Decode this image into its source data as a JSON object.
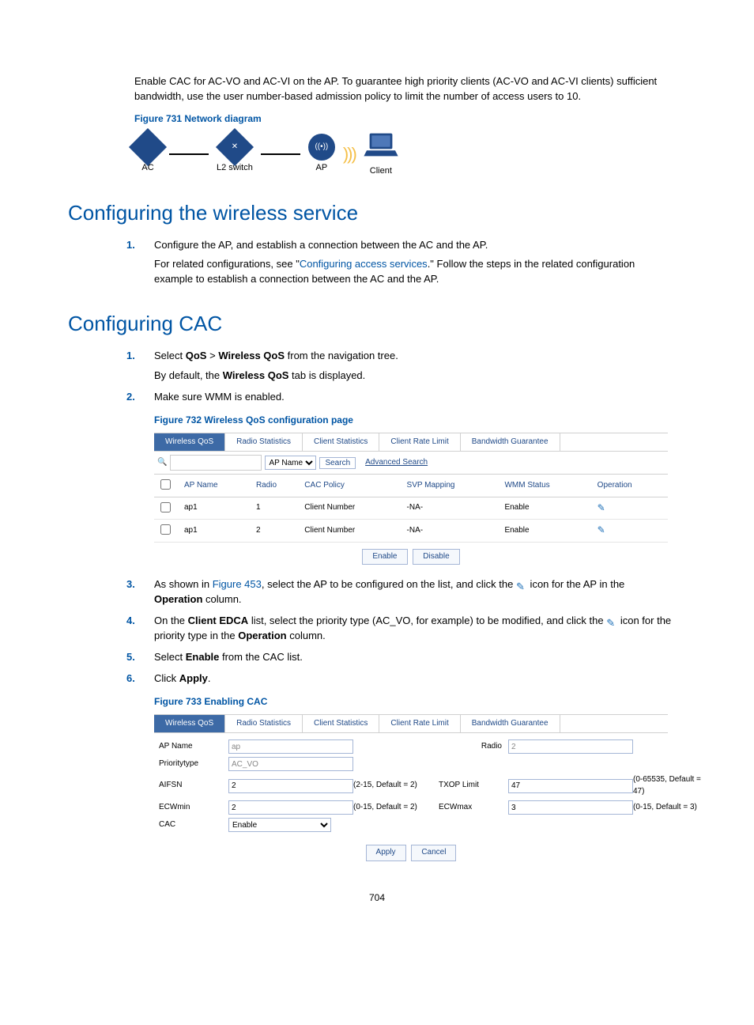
{
  "intro_paragraph": "Enable CAC for AC-VO and AC-VI on the AP. To guarantee high priority clients (AC-VO and AC-VI clients) sufficient bandwidth, use the user number-based admission policy to limit the number of access users to 10.",
  "fig731": {
    "caption": "Figure 731 Network diagram",
    "nodes": {
      "ac": "AC",
      "switch": "L2 switch",
      "ap": "AP",
      "client": "Client"
    }
  },
  "section1": {
    "title": "Configuring the wireless service",
    "steps": [
      {
        "line1": "Configure the AP, and establish a connection between the AC and the AP.",
        "line2_pre": "For related configurations, see \"",
        "line2_link": "Configuring access services",
        "line2_post": ".\" Follow the steps in the related configuration example to establish a connection between the AC and the AP."
      }
    ]
  },
  "section2": {
    "title": "Configuring CAC",
    "steps": [
      {
        "parts": [
          {
            "t": "Select "
          },
          {
            "b": "QoS"
          },
          {
            "t": " > "
          },
          {
            "b": "Wireless QoS"
          },
          {
            "t": " from the navigation tree."
          }
        ],
        "line2": [
          {
            "t": "By default, the "
          },
          {
            "b": "Wireless QoS"
          },
          {
            "t": " tab is displayed."
          }
        ]
      },
      {
        "parts": [
          {
            "t": "Make sure WMM is enabled."
          }
        ]
      }
    ],
    "steps_after_fig732": [
      {
        "num": "3.",
        "parts": [
          {
            "t": "As shown in "
          },
          {
            "link": "Figure 453"
          },
          {
            "t": ", select the AP to be configured on the list, and click the "
          },
          {
            "icon": true
          },
          {
            "t": " icon for the AP in the "
          },
          {
            "b": "Operation"
          },
          {
            "t": " column."
          }
        ]
      },
      {
        "num": "4.",
        "parts": [
          {
            "t": "On the "
          },
          {
            "b": "Client EDCA"
          },
          {
            "t": " list, select the priority type (AC_VO, for example) to be modified, and click the "
          },
          {
            "icon": true
          },
          {
            "t": " icon for the priority type in the "
          },
          {
            "b": "Operation"
          },
          {
            "t": " column."
          }
        ]
      },
      {
        "num": "5.",
        "parts": [
          {
            "t": "Select "
          },
          {
            "b": "Enable"
          },
          {
            "t": " from the CAC list."
          }
        ]
      },
      {
        "num": "6.",
        "parts": [
          {
            "t": "Click "
          },
          {
            "b": "Apply"
          },
          {
            "t": "."
          }
        ]
      }
    ]
  },
  "fig732": {
    "caption": "Figure 732 Wireless QoS configuration page",
    "tabs": [
      "Wireless QoS",
      "Radio Statistics",
      "Client Statistics",
      "Client Rate Limit",
      "Bandwidth Guarantee"
    ],
    "active_tab": 0,
    "search": {
      "dropdown": "AP Name",
      "button": "Search",
      "advanced": "Advanced Search"
    },
    "columns": [
      "",
      "AP Name",
      "Radio",
      "CAC Policy",
      "SVP Mapping",
      "WMM Status",
      "Operation"
    ],
    "rows": [
      {
        "ap": "ap1",
        "radio": "1",
        "cac": "Client Number",
        "svp": "-NA-",
        "wmm": "Enable"
      },
      {
        "ap": "ap1",
        "radio": "2",
        "cac": "Client Number",
        "svp": "-NA-",
        "wmm": "Enable"
      }
    ],
    "buttons": {
      "enable": "Enable",
      "disable": "Disable"
    }
  },
  "fig733": {
    "caption": "Figure 733 Enabling CAC",
    "tabs": [
      "Wireless QoS",
      "Radio Statistics",
      "Client Statistics",
      "Client Rate Limit",
      "Bandwidth Guarantee"
    ],
    "active_tab": 0,
    "fields": {
      "ap_name_label": "AP Name",
      "ap_name_value": "ap",
      "radio_label": "Radio",
      "radio_value": "2",
      "prio_label": "Prioritytype",
      "prio_value": "AC_VO",
      "aifsn_label": "AIFSN",
      "aifsn_value": "2",
      "aifsn_hint": "(2-15, Default = 2)",
      "txop_label": "TXOP Limit",
      "txop_value": "47",
      "txop_hint": "(0-65535, Default = 47)",
      "ecwmin_label": "ECWmin",
      "ecwmin_value": "2",
      "ecwmin_hint": "(0-15, Default = 2)",
      "ecwmax_label": "ECWmax",
      "ecwmax_value": "3",
      "ecwmax_hint": "(0-15, Default = 3)",
      "cac_label": "CAC",
      "cac_value": "Enable"
    },
    "buttons": {
      "apply": "Apply",
      "cancel": "Cancel"
    }
  },
  "page_number": "704"
}
